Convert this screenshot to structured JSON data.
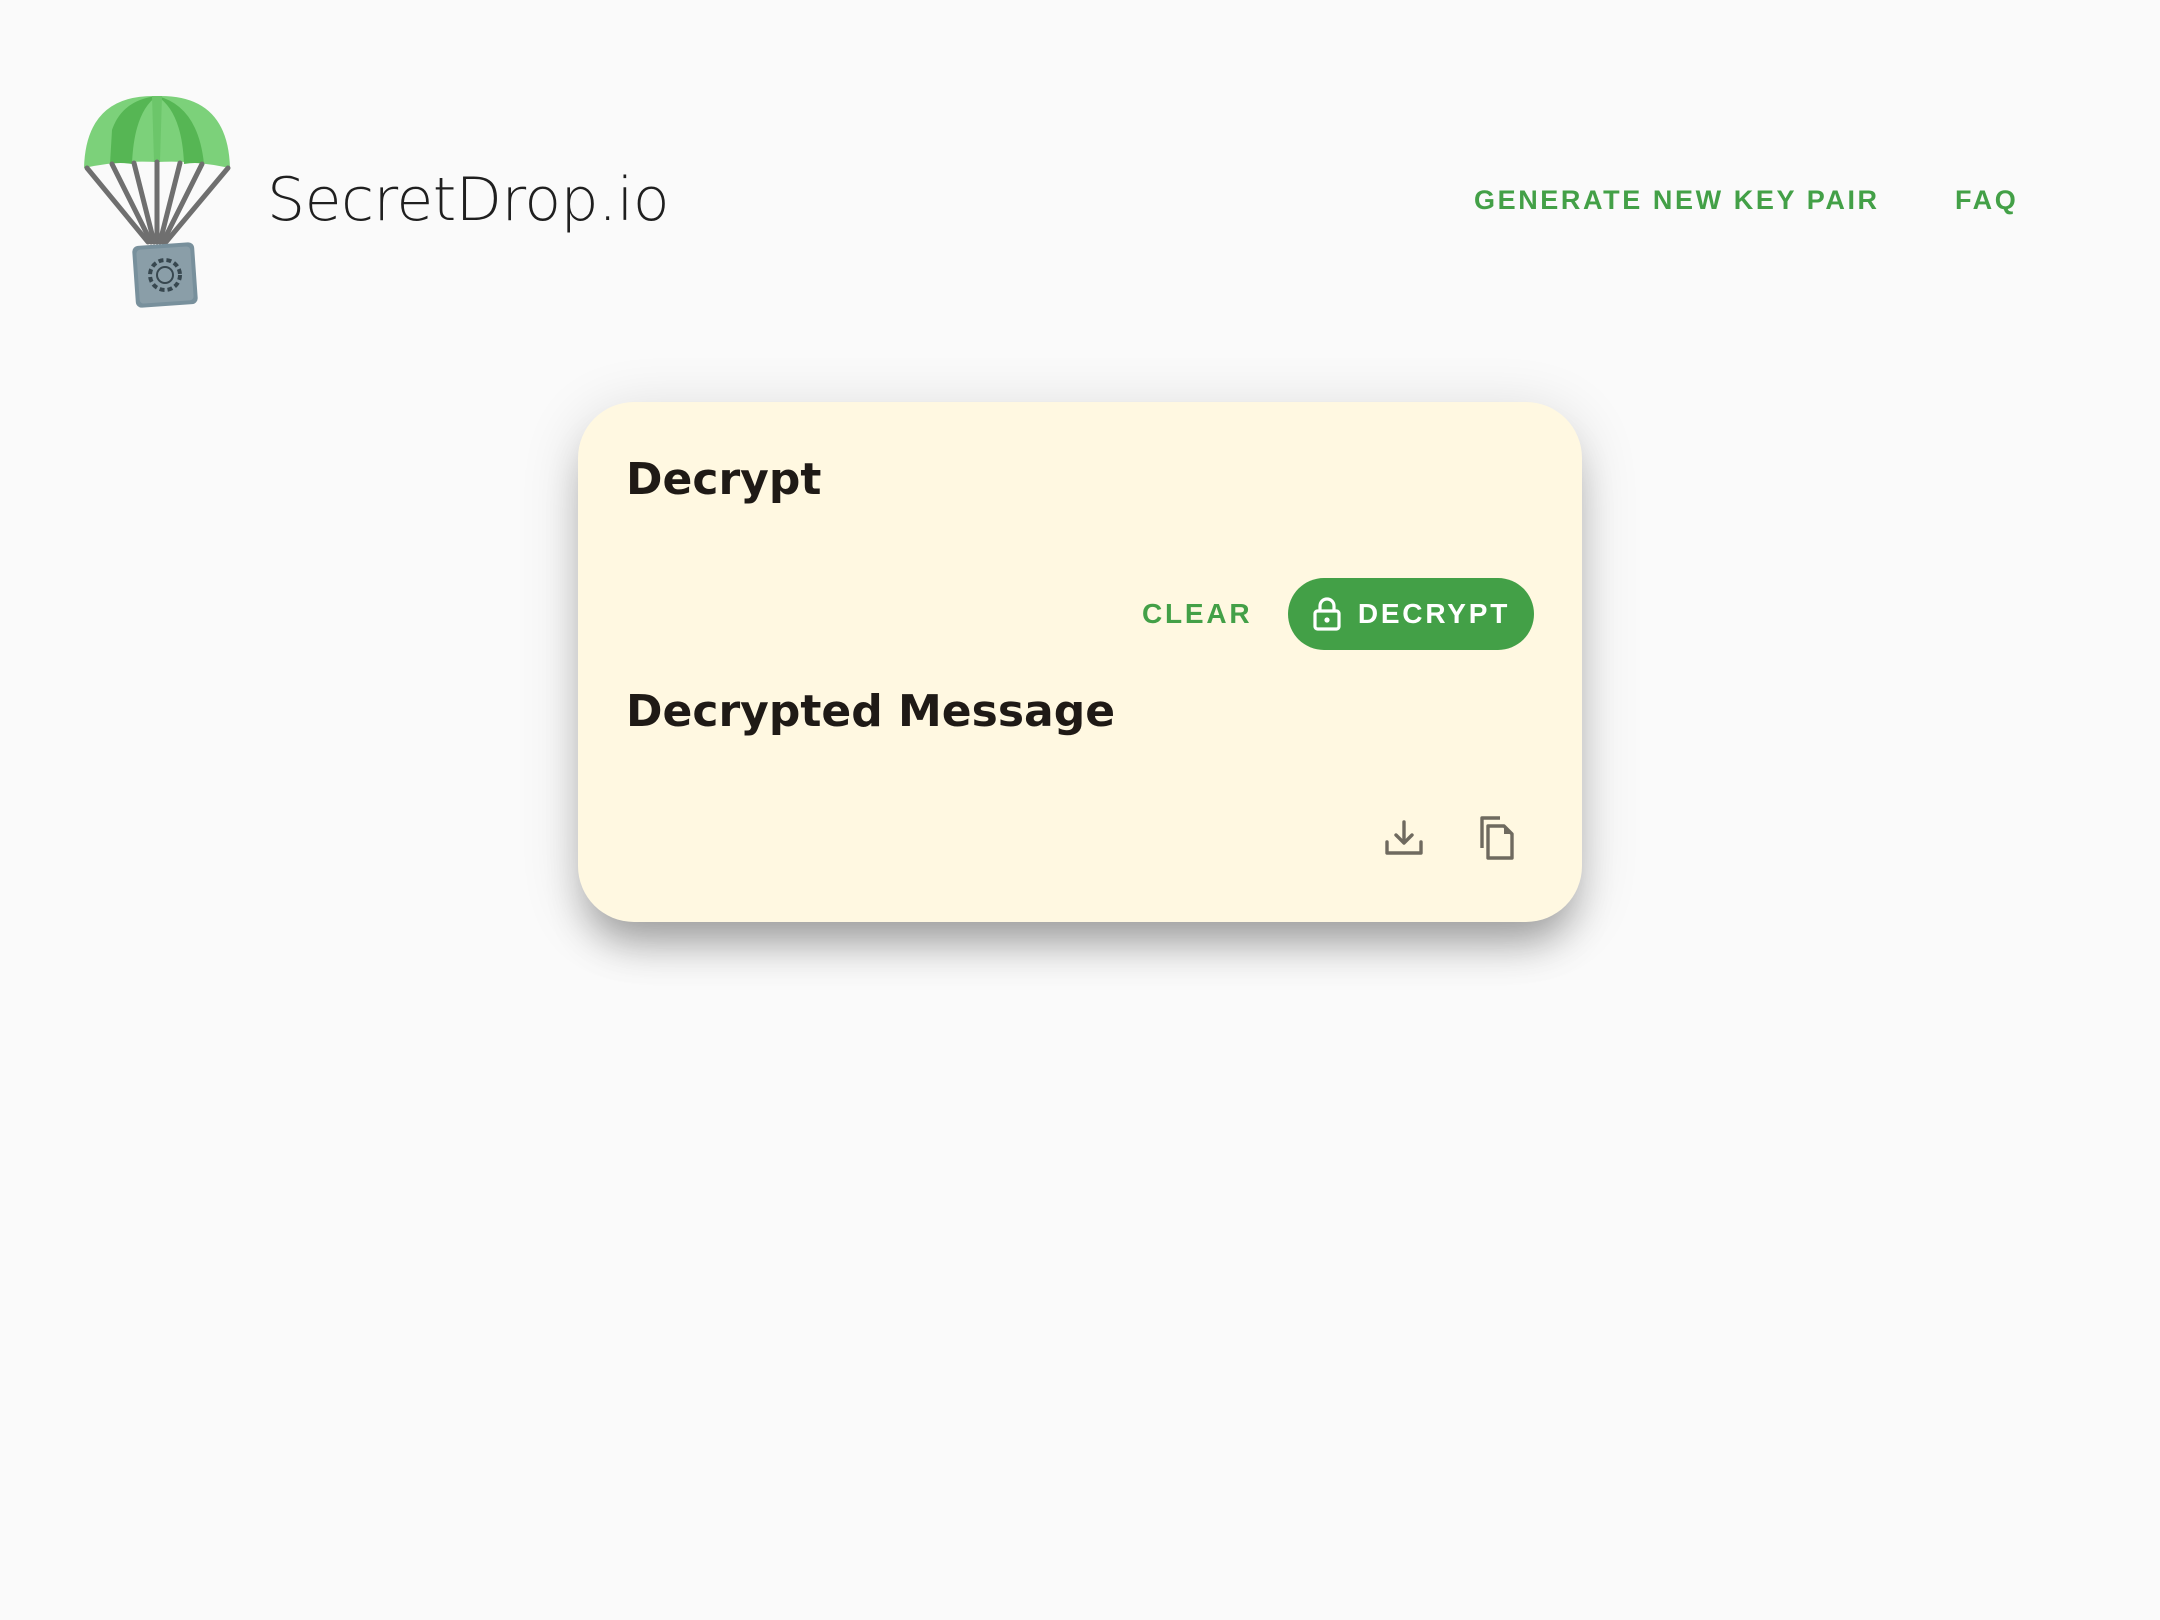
{
  "header": {
    "brand": "SecretDrop.io",
    "logo_icon": "parachute-safe-icon",
    "nav": {
      "generate_label": "GENERATE NEW KEY PAIR",
      "faq_label": "FAQ"
    }
  },
  "card": {
    "title": "Decrypt",
    "clear_label": "CLEAR",
    "decrypt_label": "DECRYPT",
    "decrypt_icon": "lock-icon",
    "output_title": "Decrypted Message",
    "download_icon": "download-icon",
    "copy_icon": "copy-icon"
  },
  "colors": {
    "accent": "#43a047",
    "page_background": "#fafafa",
    "card_background": "#fff8e1",
    "heading_text": "#1f1a16"
  }
}
